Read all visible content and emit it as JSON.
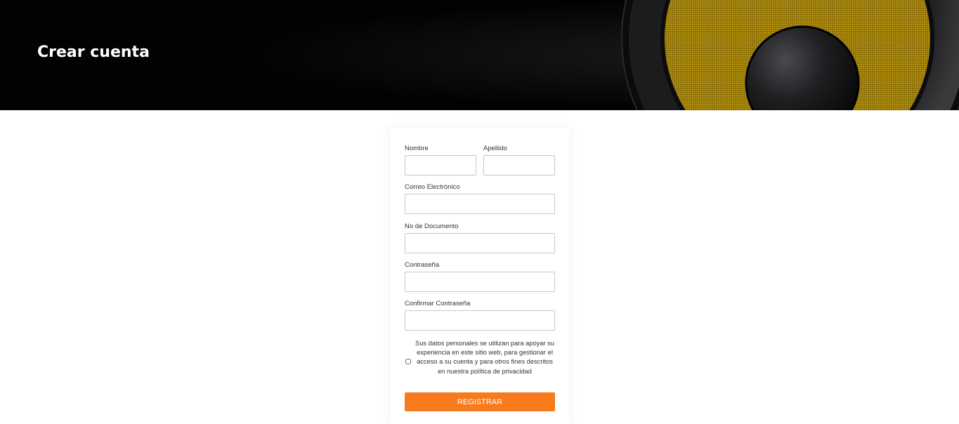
{
  "hero": {
    "title": "Crear cuenta",
    "background_color": "#020203",
    "accent_color": "#c9a312"
  },
  "form": {
    "first_name_label": "Nombre",
    "first_name_value": "",
    "last_name_label": "Apellido",
    "last_name_value": "",
    "email_label": "Correo Electrónico",
    "email_value": "",
    "document_label": "No de Documento",
    "document_value": "",
    "password_label": "Contraseña",
    "password_value": "",
    "confirm_password_label": "Confirmar Contraseña",
    "confirm_password_value": "",
    "consent_checked": false,
    "consent_text": "Sus datos personales se utilizan para apoyar su experiencia en este sitio web, para gestionar el acceso a su cuenta y para otros fines descritos en nuestra política de privacidad",
    "submit_label": "REGISTRAR",
    "submit_color": "#f77a1c"
  }
}
